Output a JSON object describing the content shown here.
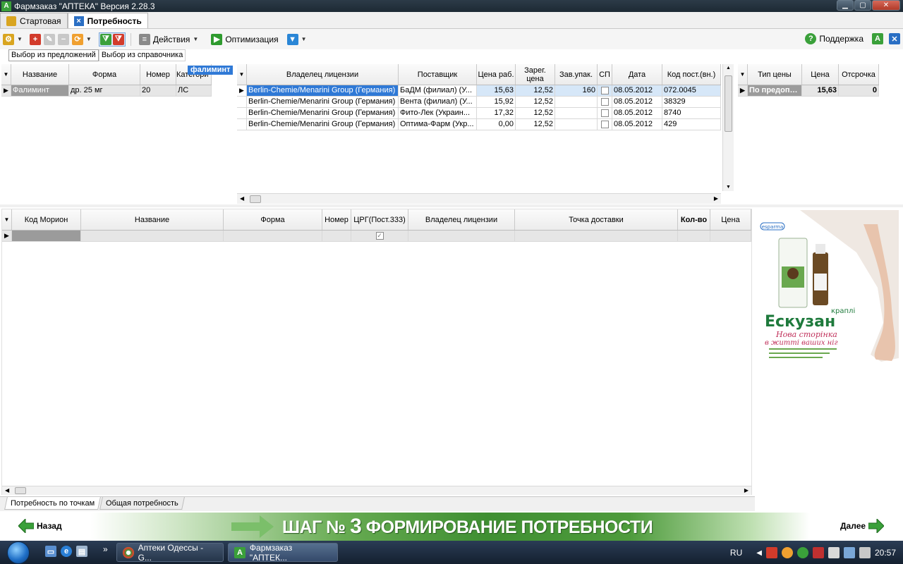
{
  "window": {
    "title": "Фармзаказ \"АПТЕКА\" Версия 2.28.3",
    "app_badge": "A"
  },
  "doc_tabs": [
    {
      "label": "Стартовая",
      "active": false
    },
    {
      "label": "Потребность",
      "active": true
    }
  ],
  "toolbar": {
    "actions_label": "Действия",
    "optimization_label": "Оптимизация",
    "support_label": "Поддержка"
  },
  "mode_tabs": [
    {
      "label": "Выбор из предложений",
      "active": true
    },
    {
      "label": "Выбор из справочника",
      "active": false
    }
  ],
  "search_popup": "фалиминт",
  "products_grid": {
    "columns": [
      "Название",
      "Форма",
      "Номер",
      "Категори"
    ],
    "rows": [
      {
        "name": "Фалиминт",
        "form": "др. 25 мг",
        "number": "20",
        "category": "ЛС"
      }
    ]
  },
  "offers_grid": {
    "columns": [
      "Владелец лицензии",
      "Поставщик",
      "Цена раб.",
      "Зарег. цена",
      "Зав.упак.",
      "СП",
      "Дата",
      "Код пост.(вн.)"
    ],
    "rows": [
      {
        "owner": "Berlin-Chemie/Menarini Group (Германия)",
        "supplier": "БаДМ (филиал) (У...",
        "price": "15,63",
        "reg_price": "12,52",
        "pack": "160",
        "date": "08.05.2012",
        "code": "072.0045"
      },
      {
        "owner": "Berlin-Chemie/Menarini Group (Германия)",
        "supplier": "Вента (филиал) (У...",
        "price": "15,92",
        "reg_price": "12,52",
        "pack": "",
        "date": "08.05.2012",
        "code": "38329"
      },
      {
        "owner": "Berlin-Chemie/Menarini Group (Германия)",
        "supplier": "Фито-Лек (Украин...",
        "price": "17,32",
        "reg_price": "12,52",
        "pack": "",
        "date": "08.05.2012",
        "code": "8740"
      },
      {
        "owner": "Berlin-Chemie/Menarini Group (Германия)",
        "supplier": "Оптима-Фарм (Укр...",
        "price": "0,00",
        "reg_price": "12,52",
        "pack": "",
        "date": "08.05.2012",
        "code": "429"
      }
    ]
  },
  "price_grid": {
    "columns": [
      "Тип цены",
      "Цена",
      "Отсрочка"
    ],
    "rows": [
      {
        "type": "По предопл...",
        "price": "15,63",
        "delay": "0"
      }
    ]
  },
  "needs_grid": {
    "columns": [
      "Код Морион",
      "Название",
      "Форма",
      "Номер",
      "ЦРГ(Пост.333)",
      "Владелец лицензии",
      "Точка доставки",
      "Кол-во",
      "Цена"
    ]
  },
  "ad": {
    "brand": "esparma",
    "subtitle": "краплі",
    "product": "Ескузан",
    "slogan_1": "Нова сторінка",
    "slogan_2": "в житті ваших ніг"
  },
  "bottom_tabs": [
    {
      "label": "Потребность по точкам",
      "active": true
    },
    {
      "label": "Общая потребность",
      "active": false
    }
  ],
  "step": {
    "back_label": "Назад",
    "next_label": "Далее",
    "prefix": "ШАГ №",
    "number": "3",
    "title": "ФОРМИРОВАНИЕ ПОТРЕБНОСТИ"
  },
  "taskbar": {
    "task_1": "Аптеки Одессы - G...",
    "task_2": "Фармзаказ \"АПТЕК...",
    "lang": "RU",
    "clock": "20:57",
    "overflow": "»"
  },
  "colors": {
    "selection": "#d6e7f8",
    "step_green": "#3f8f32",
    "title_bar": "#1d2a34"
  }
}
